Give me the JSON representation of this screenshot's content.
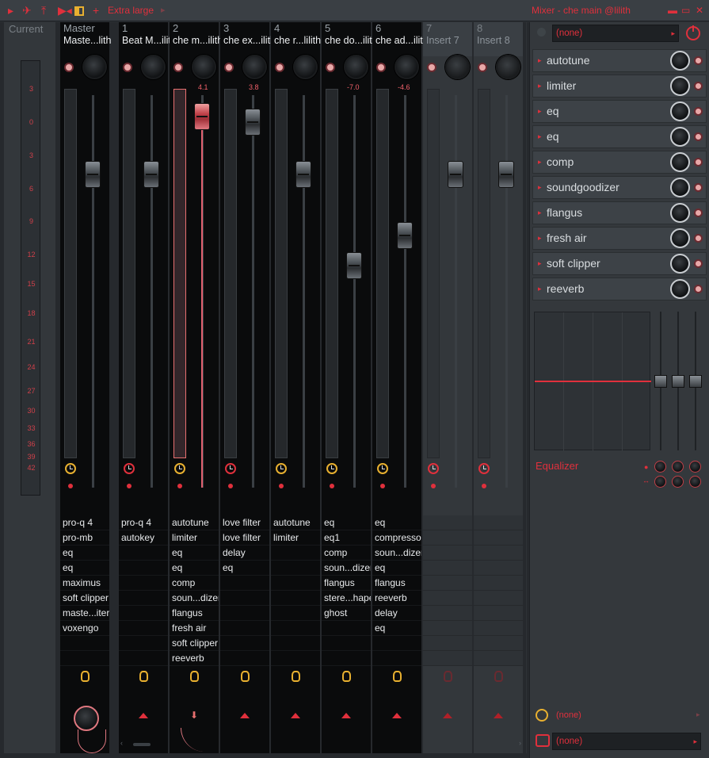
{
  "titlebar": {
    "zoom_label": "Extra large",
    "window_title": "Mixer - che main @lilith"
  },
  "current_strip": {
    "label": "Current",
    "db_ticks": [
      "3",
      "0",
      "3",
      "6",
      "9",
      "12",
      "15",
      "18",
      "21",
      "24",
      "27",
      "30",
      "33",
      "36",
      "39",
      "42"
    ]
  },
  "strips": [
    {
      "num": "Master",
      "name": "Maste...lith",
      "vol": "",
      "slots": [
        "pro-q 4",
        "pro-mb",
        "eq",
        "eq",
        "maximus",
        "soft clipper",
        "maste...iter",
        "voxengo"
      ]
    },
    {
      "num": "1",
      "name": "Beat M...ilith",
      "vol": "",
      "slots": [
        "pro-q 4",
        "autokey"
      ]
    },
    {
      "num": "2",
      "name": "che m...ilith",
      "vol": "4.1",
      "slots": [
        "autotune",
        "limiter",
        "eq",
        "eq",
        "comp",
        "soun...dizer",
        "flangus",
        "fresh air",
        "soft clipper",
        "reeverb"
      ]
    },
    {
      "num": "3",
      "name": "che ex...ilith",
      "vol": "3.8",
      "slots": [
        "love filter",
        "love filter",
        "delay",
        "eq"
      ]
    },
    {
      "num": "4",
      "name": "che r...lilith",
      "vol": "",
      "slots": [
        "autotune",
        "limiter"
      ]
    },
    {
      "num": "5",
      "name": "che do...ilith",
      "vol": "-7.0",
      "slots": [
        "eq",
        "eq1",
        "comp",
        "soun...dizer",
        "flangus",
        "stere...haper",
        "ghost"
      ]
    },
    {
      "num": "6",
      "name": "che ad...ilith",
      "vol": "-4.6",
      "slots": [
        "eq",
        "compressor",
        "soun...dizer",
        "eq",
        "flangus",
        "reeverb",
        "delay",
        "eq"
      ]
    },
    {
      "num": "7",
      "name": "Insert 7",
      "vol": "",
      "slots": []
    },
    {
      "num": "8",
      "name": "Insert 8",
      "vol": "",
      "slots": []
    }
  ],
  "panel": {
    "preset_value": "(none)",
    "fx_slots": [
      "autotune",
      "limiter",
      "eq",
      "eq",
      "comp",
      "soundgoodizer",
      "flangus",
      "fresh air",
      "soft clipper",
      "reeverb"
    ],
    "eq_title": "Equalizer",
    "bottom_clock_value": "(none)",
    "output_value": "(none)"
  },
  "colors": {
    "accent": "#e0303c",
    "clock_amber": "#e8b030",
    "background": "#2b2f33"
  }
}
